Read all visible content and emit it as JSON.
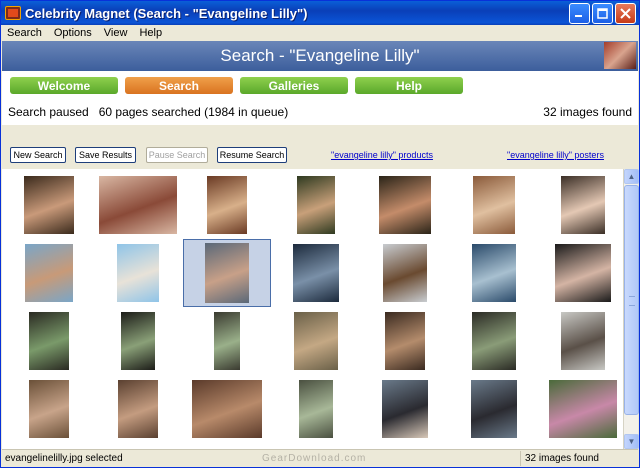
{
  "window": {
    "title": "Celebrity Magnet (Search - \"Evangeline Lilly\")"
  },
  "menu": [
    "Search",
    "Options",
    "View",
    "Help"
  ],
  "banner": {
    "title": "Search - \"Evangeline Lilly\""
  },
  "nav": {
    "items": [
      {
        "label": "Welcome",
        "active": false
      },
      {
        "label": "Search",
        "active": true
      },
      {
        "label": "Galleries",
        "active": false
      },
      {
        "label": "Help",
        "active": false
      }
    ]
  },
  "status": {
    "progress_text": "Search paused   60 pages searched (1984 in queue)",
    "images_found": "32 images found"
  },
  "toolbar": {
    "new_search": "New Search",
    "save_results": "Save Results",
    "pause_search": "Pause Search",
    "resume_search": "Resume Search",
    "products_link": "\"evangeline lilly\" products",
    "posters_link": "\"evangeline lilly\" posters"
  },
  "grid": {
    "rows": 4,
    "columns": 7,
    "selected_index": 9
  },
  "statusbar": {
    "selected_file": "evangelinelilly.jpg selected",
    "watermark": "GearDownload.com",
    "images_found": "32 images found"
  },
  "colors": {
    "accent": "#0a3fb8",
    "nav_green": "#6fbb38",
    "nav_orange": "#e58a2c",
    "banner": "#4c6ea8"
  }
}
